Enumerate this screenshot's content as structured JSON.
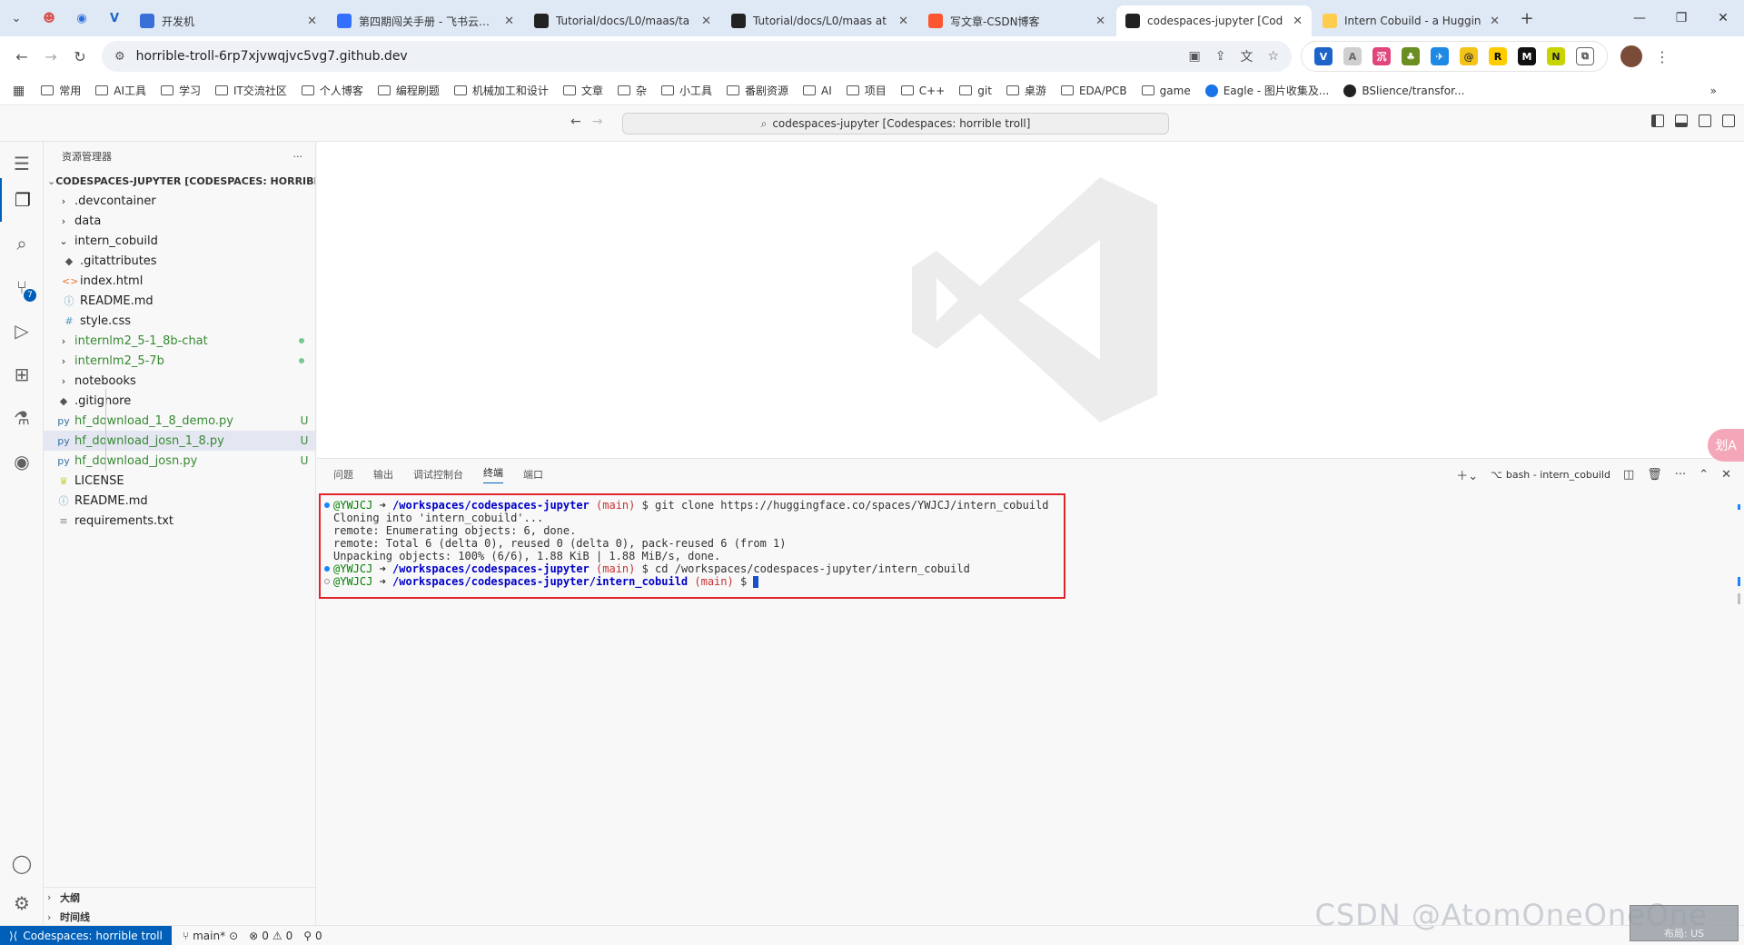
{
  "browser": {
    "tabs": [
      {
        "label": "开发机",
        "color": "#3b6fd8"
      },
      {
        "label": "第四期闯关手册 - 飞书云文档",
        "color": "#3370ff"
      },
      {
        "label": "Tutorial/docs/L0/maas/ta",
        "color": "#222222"
      },
      {
        "label": "Tutorial/docs/L0/maas at",
        "color": "#222222"
      },
      {
        "label": "写文章-CSDN博客",
        "color": "#fc5531"
      },
      {
        "label": "codespaces-jupyter [Cod",
        "color": "#222222",
        "active": true
      },
      {
        "label": "Intern Cobuild - a Huggin",
        "color": "#ffcc4d"
      }
    ],
    "new_tab": "+",
    "url": "horrible-troll-6rp7xjvwqjvc5vg7.github.dev",
    "bookmarks": [
      "常用",
      "AI工具",
      "学习",
      "IT交流社区",
      "个人博客",
      "编程刷题",
      "机械加工和设计",
      "文章",
      "杂",
      "小工具",
      "番剧资源",
      "AI",
      "项目",
      "C++",
      "git",
      "桌游",
      "EDA/PCB",
      "game",
      "Eagle - 图片收集及...",
      "BSlience/transfor..."
    ],
    "bookmarks_more": "»"
  },
  "vscode": {
    "command_center": "codespaces-jupyter [Codespaces: horrible troll]",
    "explorer_title": "资源管理器",
    "explorer_more": "···",
    "root_label": "CODESPACES-JUPYTER [CODESPACES: HORRIBLE TR...",
    "scm_badge": "7",
    "tree": [
      {
        "name": ".devcontainer",
        "type": "folder",
        "level": 0,
        "icon": "›"
      },
      {
        "name": "data",
        "type": "folder",
        "level": 0,
        "icon": "›"
      },
      {
        "name": "intern_cobuild",
        "type": "folder-open",
        "level": 0,
        "icon": "⌄"
      },
      {
        "name": ".gitattributes",
        "type": "file",
        "level": 1,
        "icon": "◆",
        "icon_color": "#555555"
      },
      {
        "name": "index.html",
        "type": "file",
        "level": 1,
        "icon": "<>",
        "icon_color": "#e37933"
      },
      {
        "name": "README.md",
        "type": "file",
        "level": 1,
        "icon": "ⓘ",
        "icon_color": "#519aba"
      },
      {
        "name": "style.css",
        "type": "file",
        "level": 1,
        "icon": "#",
        "icon_color": "#519aba"
      },
      {
        "name": "internlm2_5-1_8b-chat",
        "type": "folder",
        "level": 0,
        "icon": "›",
        "green": true,
        "dot": true
      },
      {
        "name": "internlm2_5-7b",
        "type": "folder",
        "level": 0,
        "icon": "›",
        "green": true,
        "dot": true
      },
      {
        "name": "notebooks",
        "type": "folder",
        "level": 0,
        "icon": "›"
      },
      {
        "name": ".gitignore",
        "type": "file",
        "level": 0,
        "icon": "◆",
        "icon_color": "#555555"
      },
      {
        "name": "hf_download_1_8_demo.py",
        "type": "file",
        "level": 0,
        "icon": "py",
        "icon_color": "#3572a5",
        "green": true,
        "deco": "U"
      },
      {
        "name": "hf_download_josn_1_8.py",
        "type": "file",
        "level": 0,
        "icon": "py",
        "icon_color": "#3572a5",
        "green": true,
        "deco": "U",
        "selected": true
      },
      {
        "name": "hf_download_josn.py",
        "type": "file",
        "level": 0,
        "icon": "py",
        "icon_color": "#3572a5",
        "green": true,
        "deco": "U"
      },
      {
        "name": "LICENSE",
        "type": "file",
        "level": 0,
        "icon": "♛",
        "icon_color": "#cbcb41"
      },
      {
        "name": "README.md",
        "type": "file",
        "level": 0,
        "icon": "ⓘ",
        "icon_color": "#519aba"
      },
      {
        "name": "requirements.txt",
        "type": "file",
        "level": 0,
        "icon": "≡",
        "icon_color": "#888888"
      }
    ],
    "outline_label": "大纲",
    "timeline_label": "时间线",
    "panel_tabs": [
      "问题",
      "输出",
      "调试控制台",
      "终端",
      "端口"
    ],
    "active_panel_tab": "终端",
    "terminal_name": "bash - intern_cobuild",
    "terminal_lines": [
      {
        "kind": "prompt",
        "user": "@YWJCJ",
        "arrow": " ➜ ",
        "path": "/workspaces/codespaces-jupyter",
        "branch": " (main)",
        "cmd": " $ git clone https://huggingface.co/spaces/YWJCJ/intern_cobuild",
        "dot": "filled"
      },
      {
        "kind": "out",
        "text": "Cloning into 'intern_cobuild'..."
      },
      {
        "kind": "out",
        "text": "remote: Enumerating objects: 6, done."
      },
      {
        "kind": "out",
        "text": "remote: Total 6 (delta 0), reused 0 (delta 0), pack-reused 6 (from 1)"
      },
      {
        "kind": "out",
        "text": "Unpacking objects: 100% (6/6), 1.88 KiB | 1.88 MiB/s, done."
      },
      {
        "kind": "prompt",
        "user": "@YWJCJ",
        "arrow": " ➜ ",
        "path": "/workspaces/codespaces-jupyter",
        "branch": " (main)",
        "cmd": " $ cd /workspaces/codespaces-jupyter/intern_cobuild",
        "dot": "filled"
      },
      {
        "kind": "prompt",
        "user": "@YWJCJ",
        "arrow": " ➜ ",
        "path": "/workspaces/codespaces-jupyter/intern_cobuild",
        "branch": " (main)",
        "cmd": " $ ",
        "dot": "hollow",
        "cursor": true
      }
    ],
    "status": {
      "remote": "Codespaces: horrible troll",
      "branch": "main*",
      "errors": "0",
      "warnings": "0",
      "ports": "0"
    }
  },
  "overlay": {
    "watermark": "CSDN @AtomOneOneOne",
    "thumb_text": "布局: US",
    "float_label": "划A"
  },
  "colors": {
    "accent": "#005fb8",
    "terminal_border": "#e0242b",
    "scm_green": "#388a34"
  }
}
